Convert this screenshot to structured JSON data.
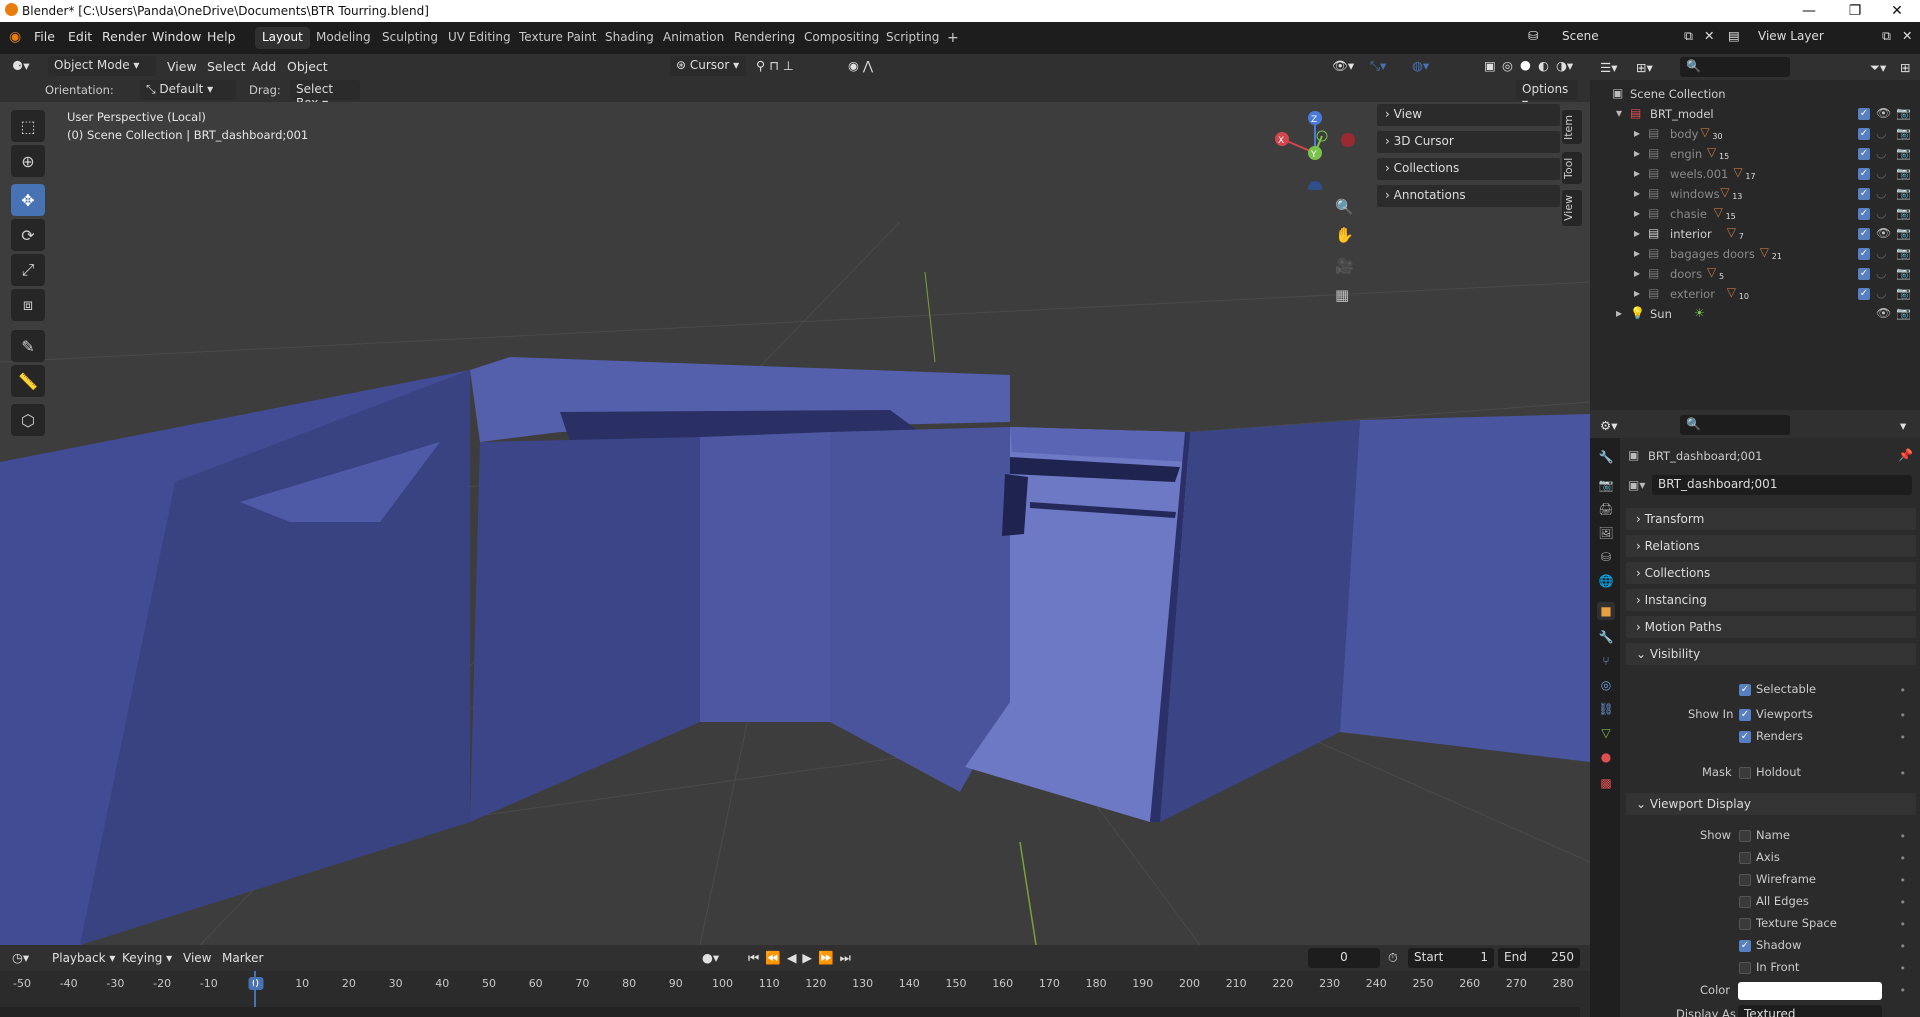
{
  "window": {
    "title": "Blender* [C:\\Users\\Panda\\OneDrive\\Documents\\BTR Tourring.blend]",
    "minimize": "—",
    "maximize": "❐",
    "close": "✕"
  },
  "menu": [
    "File",
    "Edit",
    "Render",
    "Window",
    "Help"
  ],
  "workspaces": [
    "Layout",
    "Modeling",
    "Sculpting",
    "UV Editing",
    "Texture Paint",
    "Shading",
    "Animation",
    "Rendering",
    "Compositing",
    "Scripting"
  ],
  "workspace_add": "+",
  "scene": {
    "name": "Scene",
    "view_layer": "View Layer"
  },
  "viewport_header": {
    "mode": "Object Mode",
    "menus": [
      "View",
      "Select",
      "Add",
      "Object"
    ],
    "pivot": "Cursor",
    "options": "Options"
  },
  "tool_settings": {
    "orientation_label": "Orientation:",
    "orientation_value": "Default",
    "drag_label": "Drag:",
    "drag_value": "Select Box"
  },
  "viewport_overlay": {
    "line1": "User Perspective (Local)",
    "line2": "(0) Scene Collection | BRT_dashboard;001"
  },
  "gizmo": {
    "x": "X",
    "y": "Y",
    "z": "Z"
  },
  "npanel": {
    "sections": [
      "View",
      "3D Cursor",
      "Collections",
      "Annotations"
    ],
    "tabs": [
      "Item",
      "Tool",
      "View"
    ]
  },
  "outliner": {
    "root": "Scene Collection",
    "collection": "BRT_model",
    "children": [
      {
        "name": "body",
        "count": "30"
      },
      {
        "name": "engin",
        "count": "15"
      },
      {
        "name": "weels.001",
        "count": "17"
      },
      {
        "name": "windows",
        "count": "13"
      },
      {
        "name": "chasie",
        "count": "15"
      },
      {
        "name": "interior",
        "count": "7"
      },
      {
        "name": "bagages doors",
        "count": "21"
      },
      {
        "name": "doors",
        "count": "5"
      },
      {
        "name": "exterior",
        "count": "10"
      }
    ],
    "light": "Sun"
  },
  "properties": {
    "object_name": "BRT_dashboard;001",
    "object_field": "BRT_dashboard;001",
    "sections": [
      "Transform",
      "Relations",
      "Collections",
      "Instancing",
      "Motion Paths"
    ],
    "visibility": {
      "title": "Visibility",
      "selectable": "Selectable",
      "show_in_label": "Show In",
      "viewports": "Viewports",
      "renders": "Renders",
      "mask_label": "Mask",
      "holdout": "Holdout"
    },
    "viewport_display": {
      "title": "Viewport Display",
      "show_label": "Show",
      "items": [
        "Name",
        "Axis",
        "Wireframe",
        "All Edges",
        "Texture Space",
        "Shadow",
        "In Front"
      ],
      "color_label": "Color",
      "display_as_label": "Display As",
      "display_as_value": "Textured"
    }
  },
  "timeline": {
    "menus": [
      "Playback",
      "Keying",
      "View",
      "Marker"
    ],
    "current_frame": "0",
    "start_label": "Start",
    "start": "1",
    "end_label": "End",
    "end": "250",
    "ticks": [
      "-50",
      "-40",
      "-30",
      "-20",
      "-10",
      "0",
      "10",
      "20",
      "30",
      "40",
      "50",
      "60",
      "70",
      "80",
      "90",
      "100",
      "110",
      "120",
      "130",
      "140",
      "150",
      "160",
      "170",
      "180",
      "190",
      "200",
      "210",
      "220",
      "230",
      "240",
      "250",
      "260",
      "270",
      "280"
    ]
  }
}
